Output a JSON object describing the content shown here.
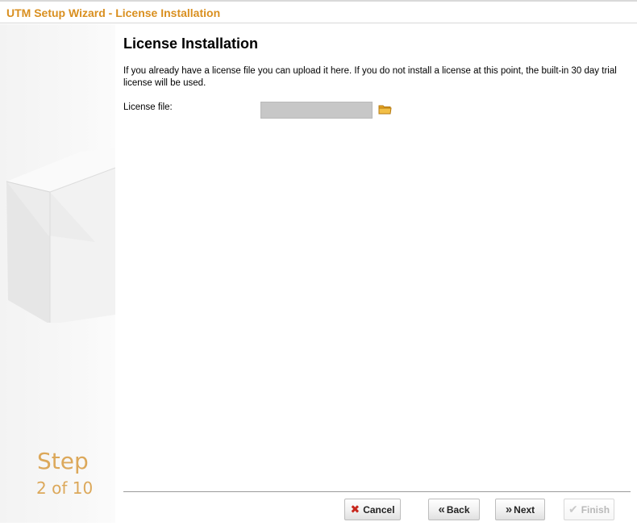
{
  "window": {
    "title": "UTM Setup Wizard - License Installation"
  },
  "sidebar": {
    "step_word": "Step",
    "step_count": "2 of 10"
  },
  "main": {
    "heading": "License Installation",
    "description": "If you already have a license file you can upload it here. If you do not install a license at this point, the built-in 30 day trial license will be used.",
    "license_field": {
      "label": "License file:",
      "value": "",
      "browse_icon": "folder-icon"
    }
  },
  "footer": {
    "cancel_label": "Cancel",
    "back_label": "Back",
    "next_label": "Next",
    "finish_label": "Finish"
  },
  "colors": {
    "title_accent": "#d98f1f",
    "step_text": "#dca85a",
    "cancel_icon": "#c7261c"
  }
}
